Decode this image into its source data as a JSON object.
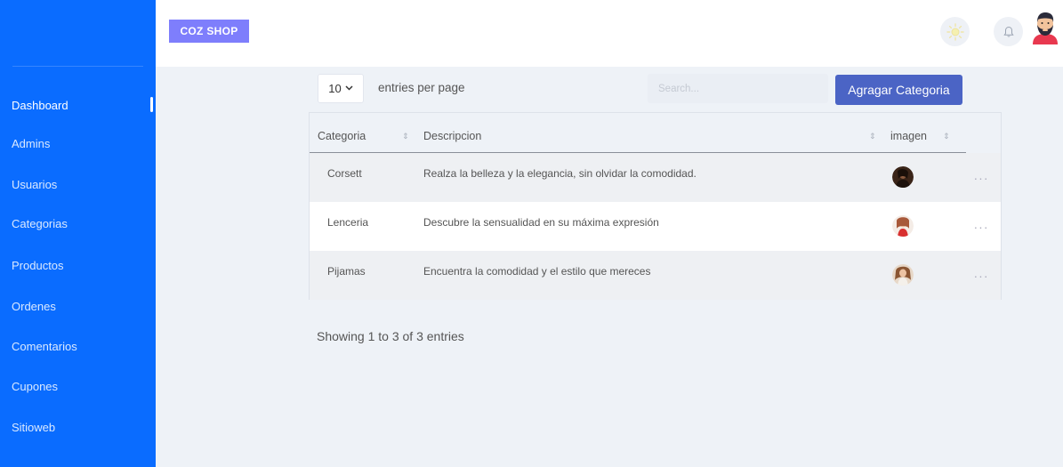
{
  "brand": {
    "name": "COZ SHOP"
  },
  "sidebar": {
    "items": [
      {
        "label": "Dashboard",
        "active": true
      },
      {
        "label": "Admins"
      },
      {
        "label": "Usuarios"
      },
      {
        "label": "Categorias"
      },
      {
        "label": "Productos"
      },
      {
        "label": "Ordenes"
      },
      {
        "label": "Comentarios"
      },
      {
        "label": "Cupones"
      },
      {
        "label": "Sitioweb"
      }
    ]
  },
  "topbar": {
    "icons": [
      "sun-icon",
      "bell-icon",
      "user-avatar"
    ]
  },
  "controls": {
    "entries_value": "10",
    "entries_label": "entries per page",
    "search_placeholder": "Search...",
    "add_button": "Agragar Categoria"
  },
  "table": {
    "headers": [
      "Categoria",
      "Descripcion",
      "imagen"
    ],
    "rows": [
      {
        "categoria": "Corsett",
        "descripcion": "Realza la belleza y la elegancia, sin olvidar la comodidad.",
        "more": "···"
      },
      {
        "categoria": "Lenceria",
        "descripcion": "Descubre la sensualidad en su máxima expresión",
        "more": "···"
      },
      {
        "categoria": "Pijamas",
        "descripcion": "Encuentra la comodidad y el estilo que mereces",
        "more": "···"
      }
    ]
  },
  "footer": {
    "showing": "Showing 1 to 3 of 3 entries"
  },
  "colors": {
    "sidebar": "#0a6cff",
    "brand": "#7e7efc",
    "primary_button": "#4b64c5",
    "background": "#eef2f7"
  }
}
